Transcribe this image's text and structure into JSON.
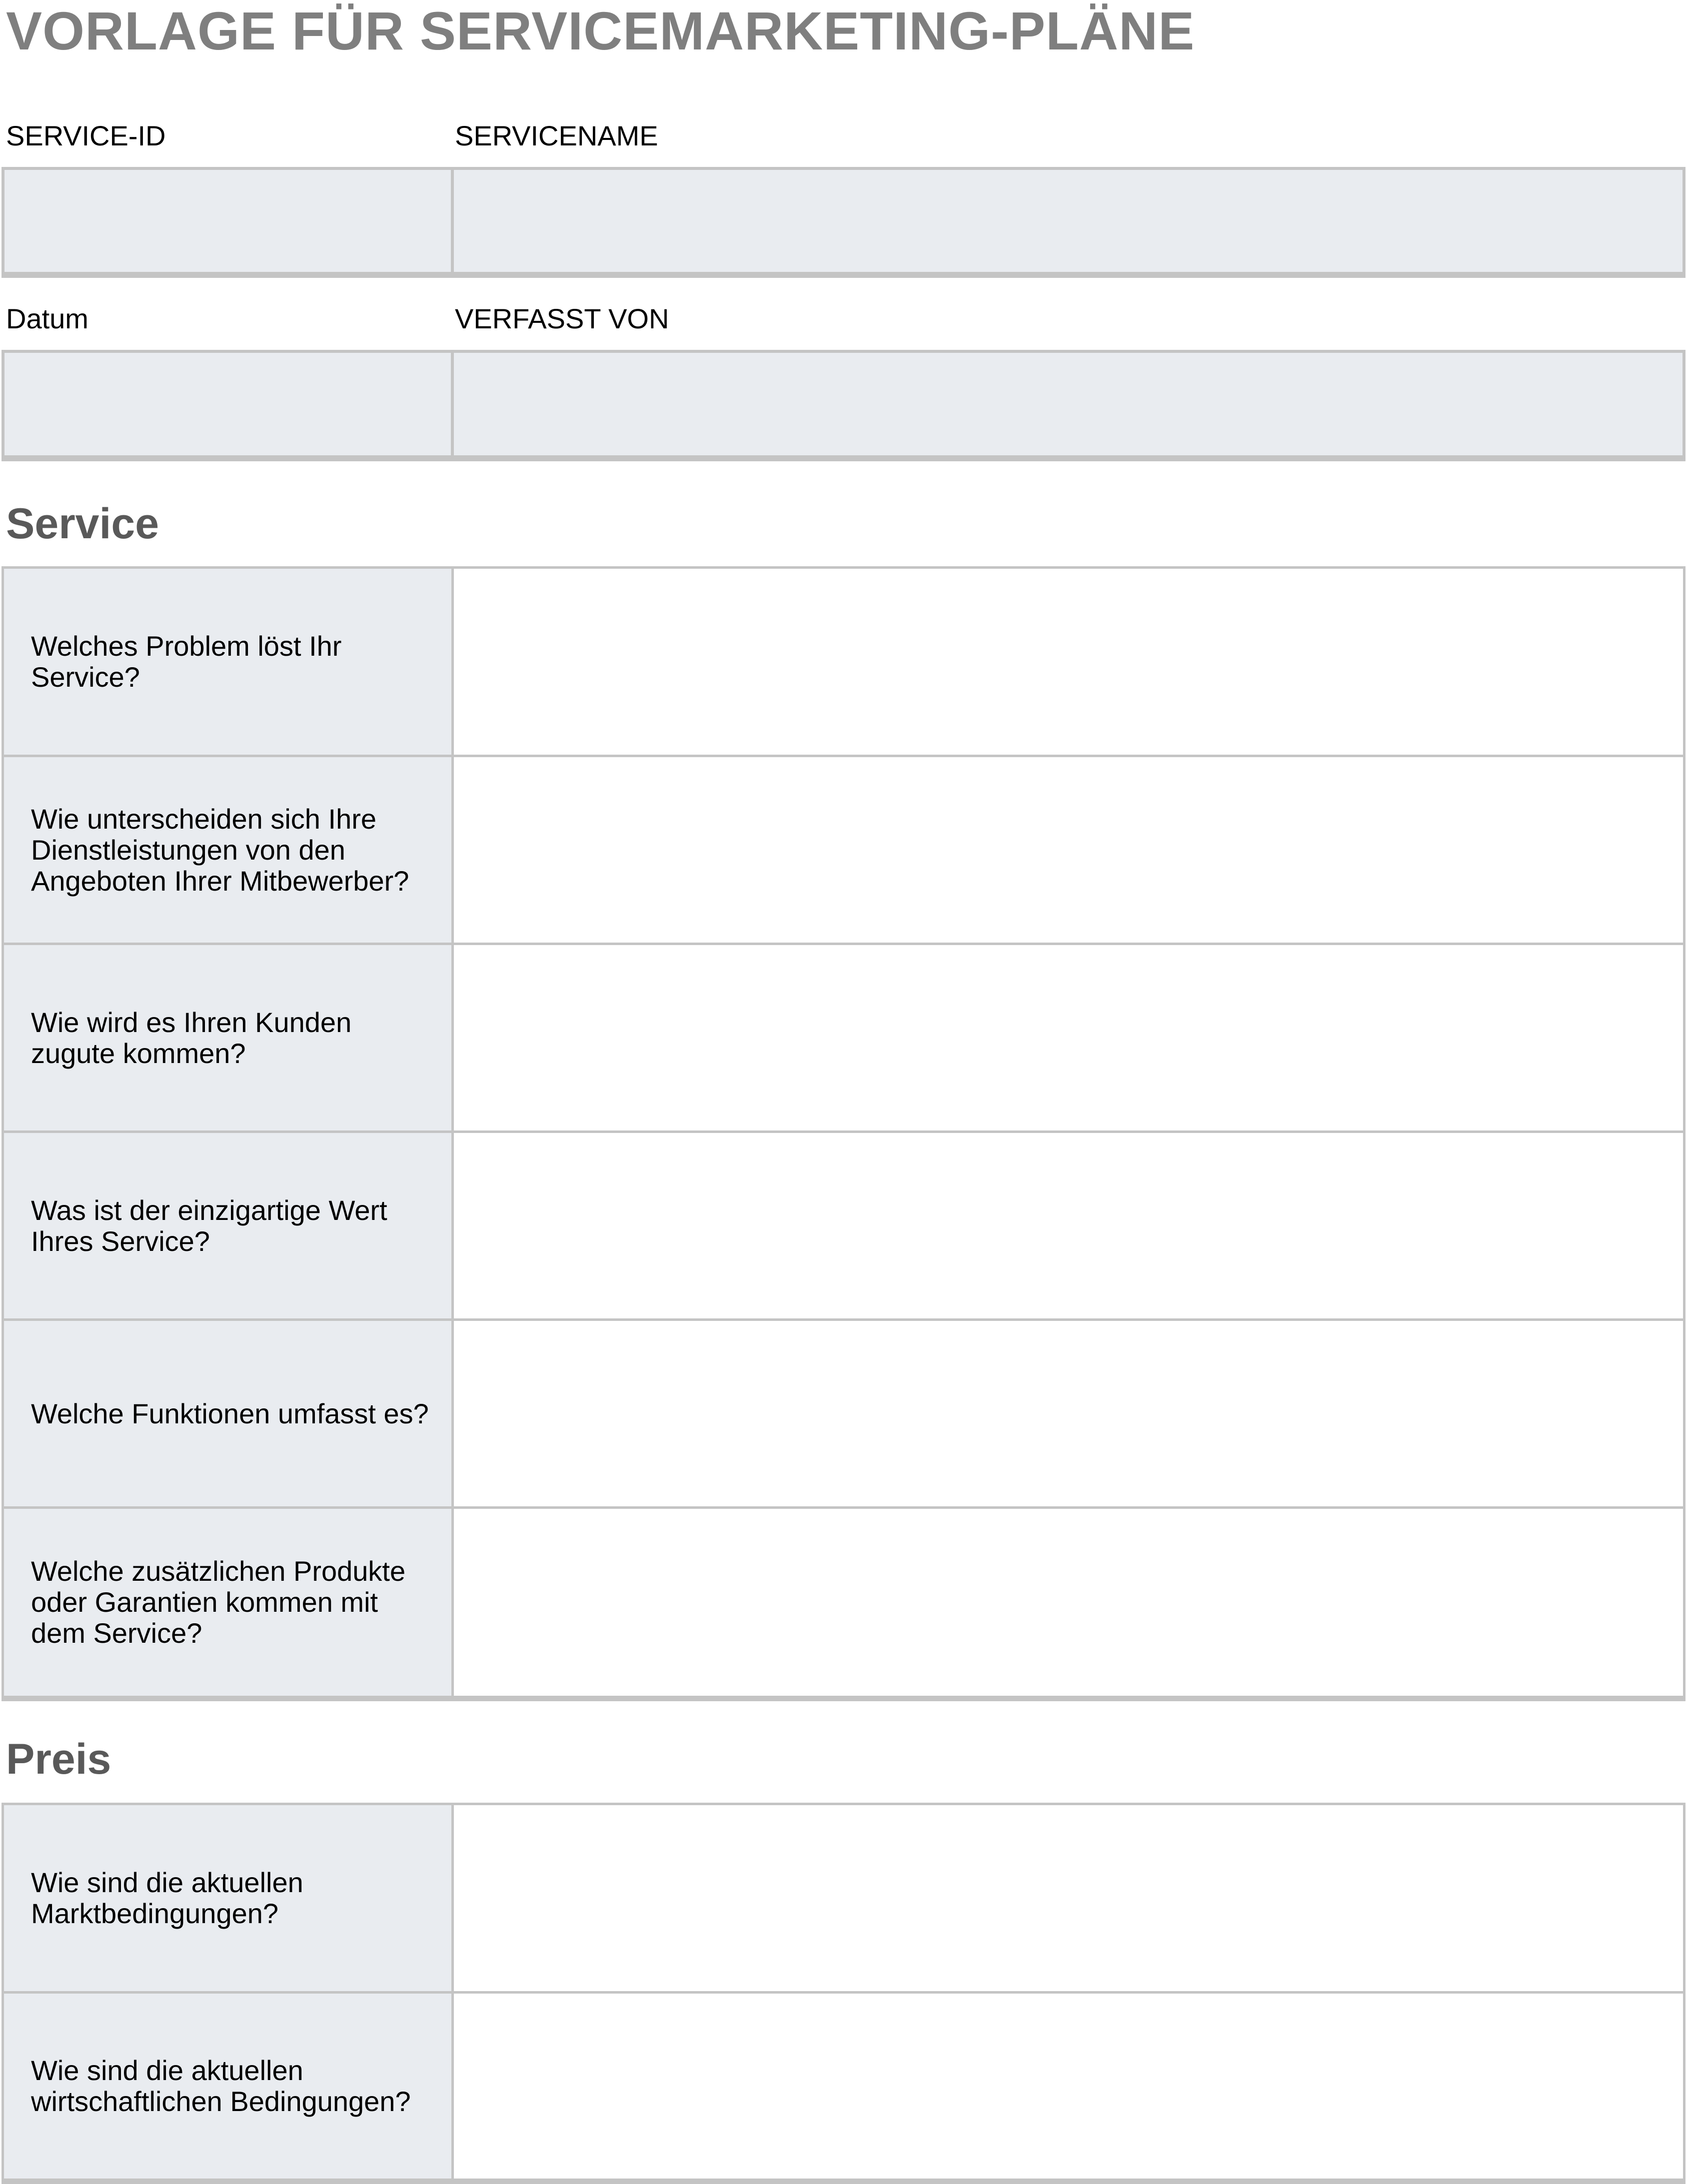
{
  "title": "VORLAGE FÜR SERVICEMARKETING-PLÄNE",
  "header_fields": {
    "service_id_label": "SERVICE-ID",
    "service_name_label": "SERVICENAME",
    "date_label": "Datum",
    "author_label": "VERFASST VON",
    "service_id_value": "",
    "service_name_value": "",
    "date_value": "",
    "author_value": ""
  },
  "sections": [
    {
      "heading": "Service",
      "questions": [
        "Welches Problem löst Ihr Service?",
        "Wie unterscheiden sich Ihre Dienstleistungen von den Angeboten Ihrer Mitbewerber?",
        "Wie wird es Ihren Kunden zugute kommen?",
        "Was ist der einzigartige Wert Ihres Service?",
        "Welche Funktionen umfasst es?",
        "Welche zusätzlichen Produkte oder Garantien kommen mit dem Service?"
      ]
    },
    {
      "heading": "Preis",
      "questions": [
        "Wie sind die aktuellen Marktbedingungen?",
        "Wie sind die aktuellen wirtschaftlichen Bedingungen?"
      ]
    }
  ],
  "colors": {
    "title": "#7f7f7f",
    "heading": "#595959",
    "cell_fill": "#e9ecf0",
    "border": "#c4c4c4"
  }
}
